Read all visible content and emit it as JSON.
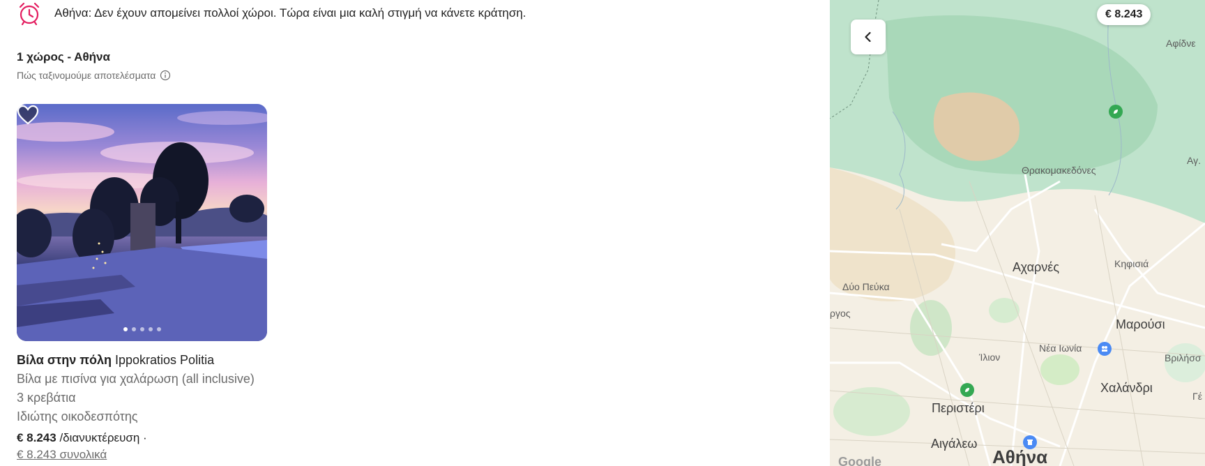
{
  "notice": {
    "text": "Αθήνα: Δεν έχουν απομείνει πολλοί χώροι. Τώρα είναι μια καλή στιγμή να κάνετε κράτηση."
  },
  "results": {
    "title": "1 χώρος - Αθήνα",
    "sort_info": "Πώς ταξινομούμε αποτελέσματα"
  },
  "listing": {
    "title_bold": "Βίλα στην πόλη",
    "title_rest": " Ippokratios Politia",
    "subtitle": "Βίλα με πισίνα για χαλάρωση (all inclusive)",
    "beds": "3 κρεβάτια",
    "host": "Ιδιώτης οικοδεσπότης",
    "price": "€ 8.243",
    "price_unit": " /διανυκτέρευση ·",
    "total": "€ 8.243 συνολικά",
    "photo_count": 5,
    "photo_index": 1
  },
  "map": {
    "price_pin": "€ 8.243",
    "labels": {
      "thrakomakedones": "Θρακομακεδόνες",
      "acharnes": "Αχαρνές",
      "kifisia": "Κηφισιά",
      "dyo_pefka": "Δύο Πεύκα",
      "argos": "ργος",
      "marousi": "Μαρούσι",
      "ilion": "Ίλιον",
      "nea_ionia": "Νέα Ιωνία",
      "vrilissia": "Βριλήσσ",
      "chalandri": "Χαλάνδρι",
      "peristeri": "Περιστέρι",
      "aigaleo": "Αιγάλεω",
      "athina": "Αθήνα",
      "afidnes": "Αφίδνε",
      "ag": "Αγ.",
      "ge": "Γέ",
      "google": "Google"
    }
  },
  "colors": {
    "alarm": "#e31c5f",
    "forest": "#bfe3cc",
    "urban": "#f4efe4"
  }
}
